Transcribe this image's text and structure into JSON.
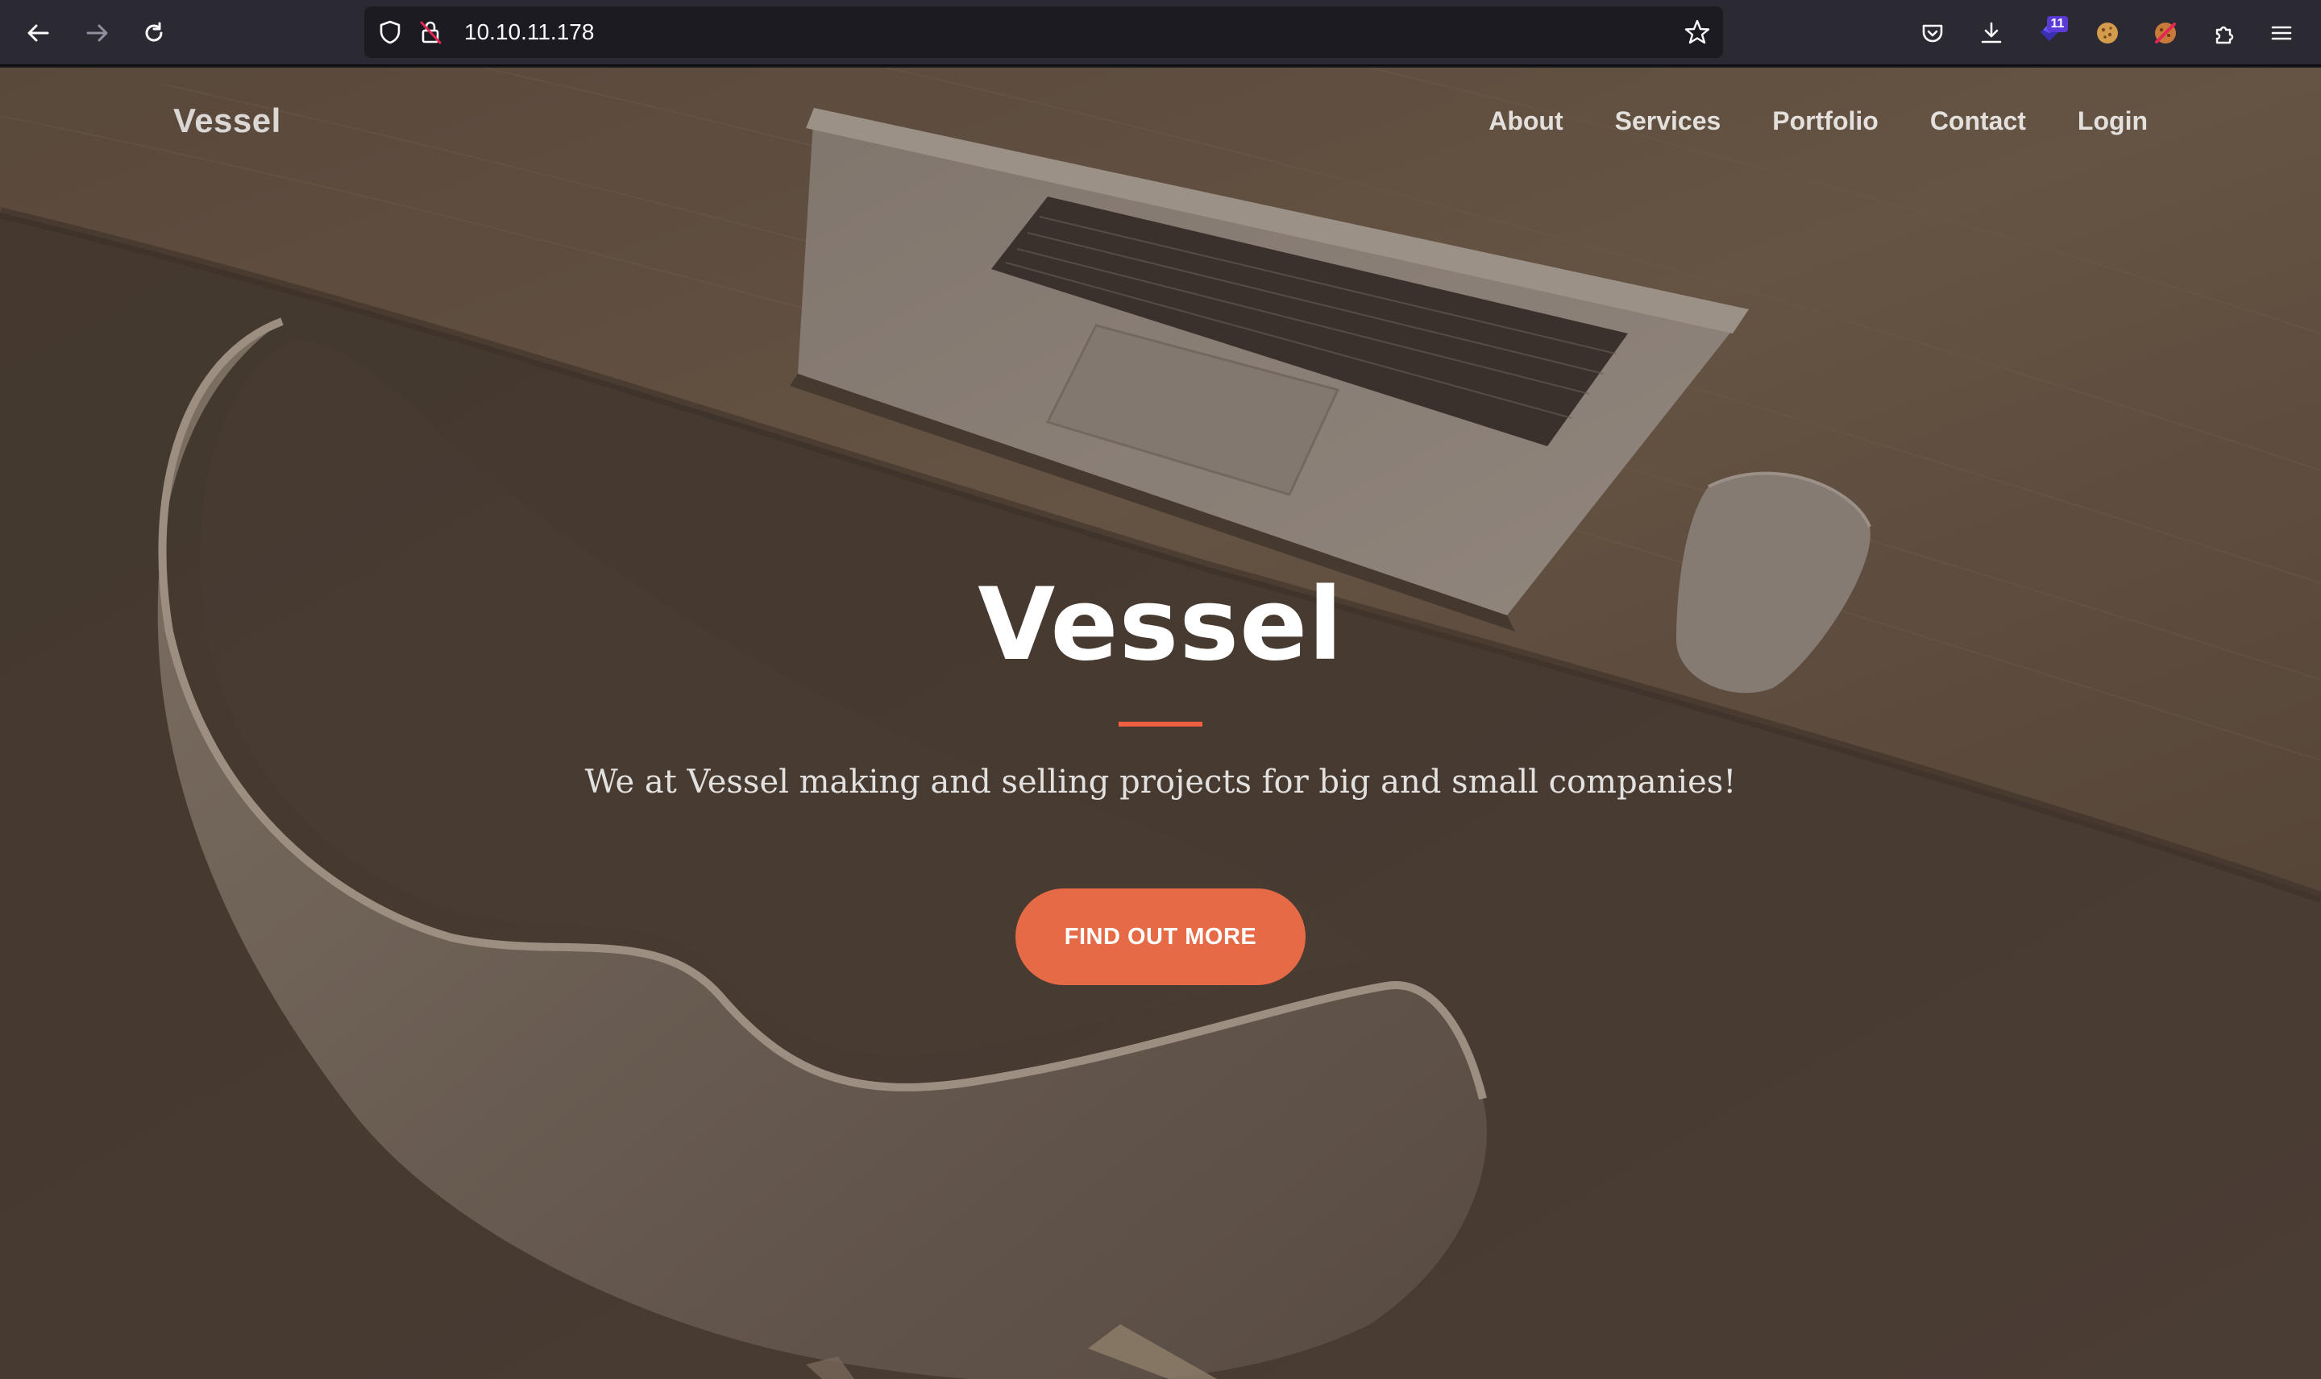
{
  "browser": {
    "url": "10.10.11.178",
    "extension_badge": "11",
    "icons": {
      "back": "arrow-left-icon",
      "forward": "arrow-right-icon",
      "reload": "reload-icon",
      "tracking": "shield-icon",
      "connection": "insecure-lock-icon",
      "bookmark": "star-icon",
      "pocket": "pocket-icon",
      "downloads": "download-icon",
      "extension1": "extension-badge-icon",
      "extension2": "cookie-icon",
      "extension3": "cookie-blocked-icon",
      "extensions": "puzzle-icon",
      "menu": "hamburger-menu-icon"
    }
  },
  "site": {
    "brand": "Vessel",
    "nav": [
      {
        "label": "About"
      },
      {
        "label": "Services"
      },
      {
        "label": "Portfolio"
      },
      {
        "label": "Contact"
      },
      {
        "label": "Login"
      }
    ],
    "hero": {
      "title": "Vessel",
      "subtitle": "We at Vessel making and selling projects for big and small companies!",
      "cta_label": "FIND OUT MORE"
    },
    "colors": {
      "accent": "#f05f40",
      "button": "#e56a45",
      "background": "#4e4339"
    }
  }
}
